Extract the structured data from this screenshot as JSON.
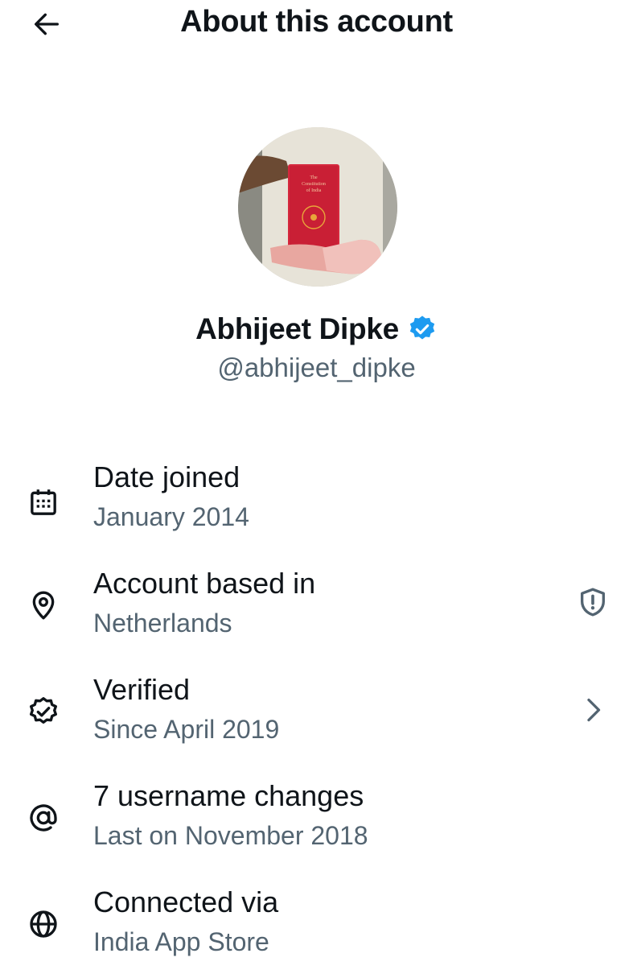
{
  "header": {
    "title": "About this account",
    "back_icon": "arrow-left-icon"
  },
  "profile": {
    "name": "Abhijeet Dipke",
    "handle": "@abhijeet_dipke",
    "verified_badge_color": "#1d9bf0",
    "avatar_book_text": "The Constitution of India"
  },
  "details": [
    {
      "icon": "calendar-icon",
      "title": "Date joined",
      "subtitle": "January 2014"
    },
    {
      "icon": "location-pin-icon",
      "title": "Account based in",
      "subtitle": "Netherlands",
      "trailing_icon": "shield-alert-icon"
    },
    {
      "icon": "verified-badge-icon",
      "title": "Verified",
      "subtitle": "Since April 2019",
      "trailing_icon": "chevron-right-icon"
    },
    {
      "icon": "at-sign-icon",
      "title": "7 username changes",
      "subtitle": "Last on November 2018"
    },
    {
      "icon": "globe-icon",
      "title": "Connected via",
      "subtitle": "India App Store"
    }
  ],
  "colors": {
    "text_primary": "#0f1419",
    "text_secondary": "#536471",
    "accent": "#1d9bf0"
  }
}
